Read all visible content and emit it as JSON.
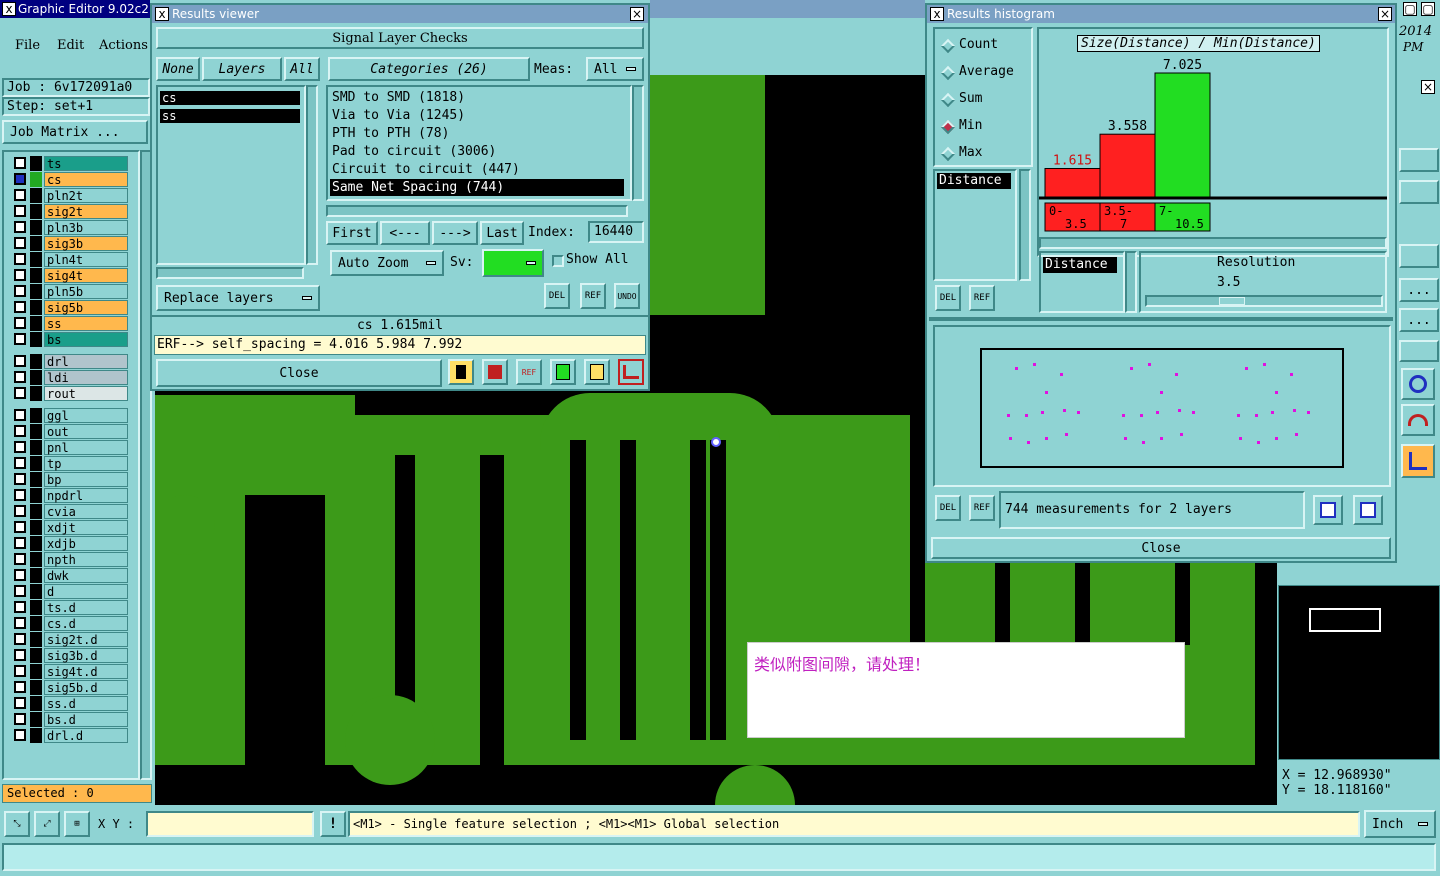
{
  "app": {
    "title": "Graphic Editor 9.02c2 (",
    "menu": [
      "File",
      "Edit",
      "Actions"
    ],
    "job_label": "Job : 6v172091a0",
    "step_label": "Step: set+1",
    "job_matrix": "Job Matrix ...",
    "clock": [
      "2014",
      "PM"
    ]
  },
  "layers": [
    {
      "name": "ts",
      "color": "#1a9e8a"
    },
    {
      "name": "cs",
      "color": "#ffb84d"
    },
    {
      "name": "pln2t",
      "color": "#8fd3d3"
    },
    {
      "name": "sig2t",
      "color": "#ffb84d"
    },
    {
      "name": "pln3b",
      "color": "#8fd3d3"
    },
    {
      "name": "sig3b",
      "color": "#ffb84d"
    },
    {
      "name": "pln4t",
      "color": "#8fd3d3"
    },
    {
      "name": "sig4t",
      "color": "#ffb84d"
    },
    {
      "name": "pln5b",
      "color": "#8fd3d3"
    },
    {
      "name": "sig5b",
      "color": "#ffb84d"
    },
    {
      "name": "ss",
      "color": "#ffb84d"
    },
    {
      "name": "bs",
      "color": "#1a9e8a"
    },
    {
      "name": "drl",
      "color": "#b0c4cc"
    },
    {
      "name": "ldi",
      "color": "#b0c4cc"
    },
    {
      "name": "rout",
      "color": "#dce6e6"
    },
    {
      "name": "ggl",
      "color": "#8fd3d3"
    },
    {
      "name": "out",
      "color": "#8fd3d3"
    },
    {
      "name": "pnl",
      "color": "#8fd3d3"
    },
    {
      "name": "tp",
      "color": "#8fd3d3"
    },
    {
      "name": "bp",
      "color": "#8fd3d3"
    },
    {
      "name": "npdrl",
      "color": "#8fd3d3"
    },
    {
      "name": "cvia",
      "color": "#8fd3d3"
    },
    {
      "name": "xdjt",
      "color": "#8fd3d3"
    },
    {
      "name": "xdjb",
      "color": "#8fd3d3"
    },
    {
      "name": "npth",
      "color": "#8fd3d3"
    },
    {
      "name": "dwk",
      "color": "#8fd3d3"
    },
    {
      "name": "d",
      "color": "#8fd3d3"
    },
    {
      "name": "ts.d",
      "color": "#8fd3d3"
    },
    {
      "name": "cs.d",
      "color": "#8fd3d3"
    },
    {
      "name": "sig2t.d",
      "color": "#8fd3d3"
    },
    {
      "name": "sig3b.d",
      "color": "#8fd3d3"
    },
    {
      "name": "sig4t.d",
      "color": "#8fd3d3"
    },
    {
      "name": "sig5b.d",
      "color": "#8fd3d3"
    },
    {
      "name": "ss.d",
      "color": "#8fd3d3"
    },
    {
      "name": "bs.d",
      "color": "#8fd3d3"
    },
    {
      "name": "drl.d",
      "color": "#8fd3d3"
    }
  ],
  "selected_count": "Selected : 0",
  "results_viewer": {
    "title": "Results viewer",
    "header": "Signal Layer Checks",
    "none": "None",
    "layers_btn": "Layers",
    "all": "All",
    "layer_list": [
      "cs",
      "ss"
    ],
    "categories": "Categories (26)",
    "meas_label": "Meas:",
    "meas_value": "All",
    "category_items": [
      "SMD to SMD (1818)",
      "Via to Via (1245)",
      "PTH to PTH (78)",
      "Pad to circuit (3006)",
      "Circuit to circuit (447)",
      "Same Net Spacing (744)"
    ],
    "first": "First",
    "prev": "<---",
    "next": "--->",
    "last": "Last",
    "index_label": "Index:",
    "index_value": "16440",
    "auto_zoom": "Auto Zoom",
    "sv_label": "Sv:",
    "show_all": "Show All",
    "replace_layers": "Replace layers",
    "del": "DEL",
    "ref": "REF",
    "undo": "UNDO",
    "status": "cs 1.615mil",
    "erf": "ERF--> self_spacing = 4.016 5.984 7.992",
    "close": "Close"
  },
  "histogram": {
    "title": "Results histogram",
    "options": [
      "Count",
      "Average",
      "Sum",
      "Min",
      "Max"
    ],
    "selected_option": "Min",
    "distance_label": "Distance",
    "chart_title": "Size(Distance) / Min(Distance)",
    "resolution_label": "Resolution",
    "resolution_value": "3.5",
    "measurements": "744 measurements for 2 layers",
    "close": "Close",
    "del": "DEL",
    "ref": "REF"
  },
  "chart_data": {
    "type": "bar",
    "title": "Size(Distance) / Min(Distance)",
    "categories": [
      "0-3.5",
      "3.5-7",
      "7-10.5"
    ],
    "values": [
      1.615,
      3.558,
      7.025
    ],
    "value_labels": [
      "1.615",
      "3.558",
      "7.025"
    ],
    "colors": [
      "#ff2020",
      "#ff2020",
      "#22dd22"
    ],
    "ylim": [
      0,
      7.025
    ]
  },
  "annotation": "类似附图间隙，请处理！",
  "coords": {
    "x": "X = 12.968930\"",
    "y": "Y = 18.118160\""
  },
  "bottom": {
    "xy_label": "X Y :",
    "xy_value": "",
    "hint": "<M1> - Single feature selection ; <M1><M1> Global selection",
    "units": "Inch"
  },
  "right_buttons": [
    "...",
    "..."
  ]
}
